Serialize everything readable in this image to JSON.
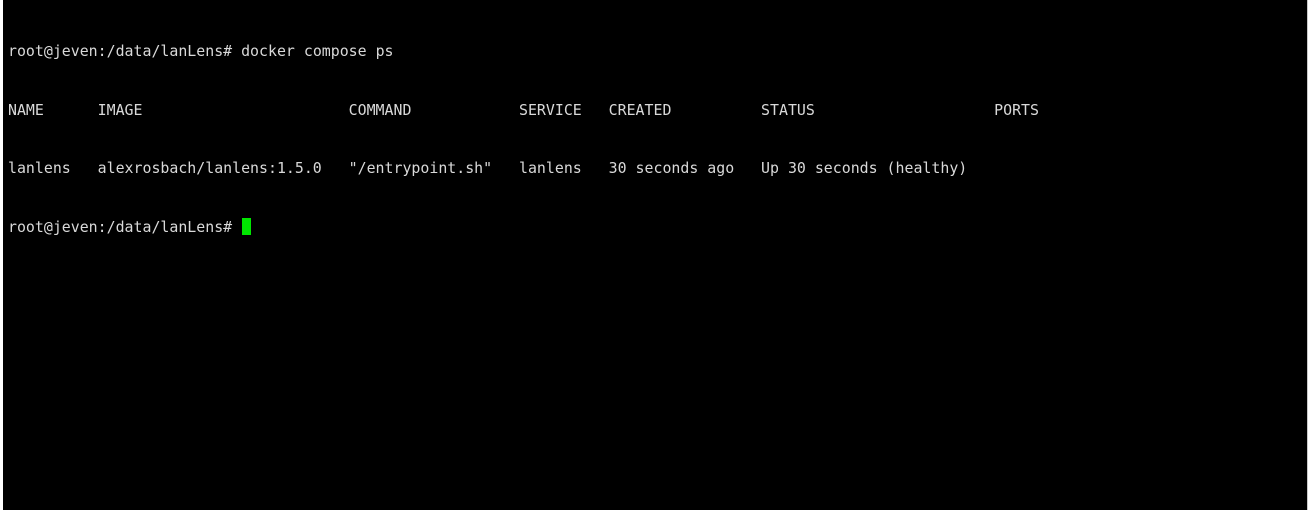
{
  "terminal": {
    "prompt": "root@jeven:/data/lanLens# ",
    "command": "docker compose ps",
    "header": "NAME      IMAGE                       COMMAND            SERVICE   CREATED          STATUS                    PORTS",
    "row": "lanlens   alexrosbach/lanlens:1.5.0   \"/entrypoint.sh\"   lanlens   30 seconds ago   Up 30 seconds (healthy)",
    "current_prompt": "root@jeven:/data/lanLens# ",
    "cursor_color": "#00e600",
    "text_color": "#d9d9d9",
    "background_color": "#000000"
  }
}
